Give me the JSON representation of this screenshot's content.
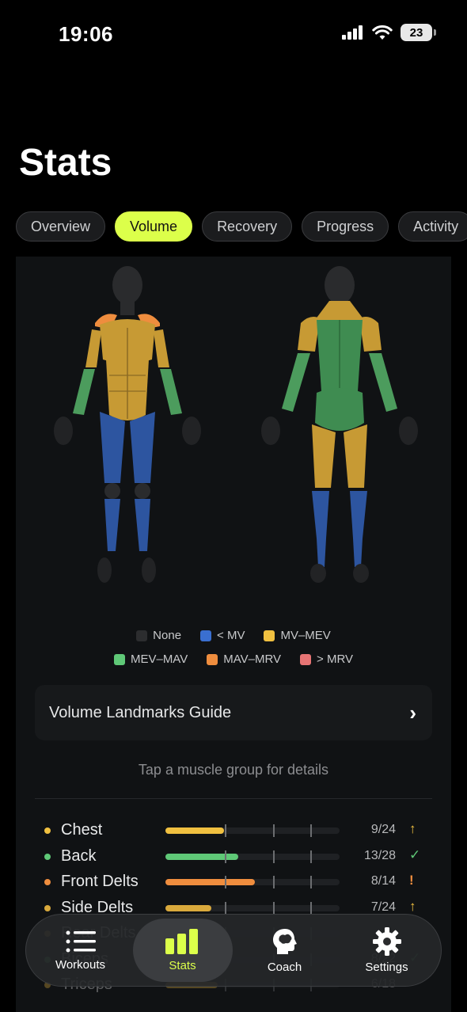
{
  "status_bar": {
    "time": "19:06",
    "battery": "23"
  },
  "page_title": "Stats",
  "tabs": [
    {
      "label": "Overview",
      "active": false
    },
    {
      "label": "Volume",
      "active": true
    },
    {
      "label": "Recovery",
      "active": false
    },
    {
      "label": "Progress",
      "active": false
    },
    {
      "label": "Activity",
      "active": false
    }
  ],
  "legend": [
    {
      "label": "None",
      "color": "#2c2d2f"
    },
    {
      "label": "< MV",
      "color": "#3a6fd0"
    },
    {
      "label": "MV–MEV",
      "color": "#f0c040"
    },
    {
      "label": "MEV–MAV",
      "color": "#5fc877"
    },
    {
      "label": "MAV–MRV",
      "color": "#ef8d3e"
    },
    {
      "label": "> MRV",
      "color": "#e67474"
    }
  ],
  "guide": {
    "label": "Volume Landmarks Guide"
  },
  "hint": "Tap a muscle group for details",
  "muscles": [
    {
      "name": "Chest",
      "value": "9/24",
      "done": 9,
      "max": 24,
      "status": "↑",
      "color": "#f0c040",
      "status_color": "#f0c040"
    },
    {
      "name": "Back",
      "value": "13/28",
      "done": 13,
      "max": 28,
      "status": "✓",
      "color": "#5fc877",
      "status_color": "#5fc877"
    },
    {
      "name": "Front Delts",
      "value": "8/14",
      "done": 8,
      "max": 14,
      "status": "!",
      "color": "#ef8d3e",
      "status_color": "#ef8d3e"
    },
    {
      "name": "Side Delts",
      "value": "7/24",
      "done": 7,
      "max": 24,
      "status": "↑",
      "color": "#d9a93c",
      "status_color": "#f0c040"
    },
    {
      "name": "Rear Delts",
      "value": "",
      "done": 0,
      "max": 24,
      "status": "",
      "color": "#d9a93c",
      "status_color": "#f0c040"
    },
    {
      "name": "Biceps",
      "value": "8/22",
      "done": 8,
      "max": 22,
      "status": "✓",
      "color": "#5fc877",
      "status_color": "#5fc877"
    },
    {
      "name": "Triceps",
      "value": "6/18",
      "done": 6,
      "max": 18,
      "status": "",
      "color": "#d9a93c",
      "status_color": "#f0c040"
    }
  ],
  "tabbar": [
    {
      "label": "Workouts",
      "icon": "list-icon",
      "active": false
    },
    {
      "label": "Stats",
      "icon": "bar-chart-icon",
      "active": true
    },
    {
      "label": "Coach",
      "icon": "brain-head-icon",
      "active": false
    },
    {
      "label": "Settings",
      "icon": "gear-icon",
      "active": false
    }
  ]
}
